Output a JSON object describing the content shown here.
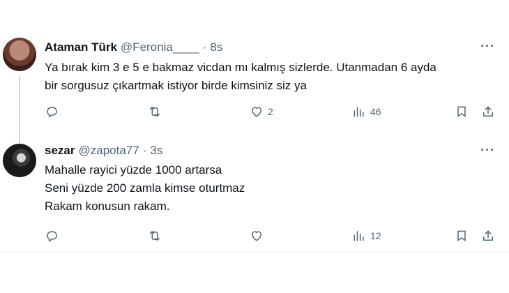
{
  "tweets": [
    {
      "name": "Ataman Türk",
      "handle": "@Feronia____",
      "separator": "·",
      "time": "8s",
      "text_lines": [
        "Ya bırak kim 3 e 5 e bakmaz vicdan mı kalmış sizlerde. Utanmadan 6 ayda",
        "bir sorgusuz çıkartmak istiyor birde kimsiniz siz ya"
      ],
      "likes": "2",
      "views": "46",
      "more": "···"
    },
    {
      "name": "sezar",
      "handle": "@zapota77",
      "separator": "·",
      "time": "3s",
      "text_lines": [
        "Mahalle rayici yüzde 1000 artarsa",
        "Seni yüzde 200 zamla kimse oturtmaz",
        "Rakam konusun rakam."
      ],
      "views": "12",
      "more": "···"
    }
  ],
  "icons": {
    "reply": "reply-icon",
    "retweet": "retweet-icon",
    "like": "heart-icon",
    "views": "views-icon",
    "bookmark": "bookmark-icon",
    "share": "share-icon"
  }
}
